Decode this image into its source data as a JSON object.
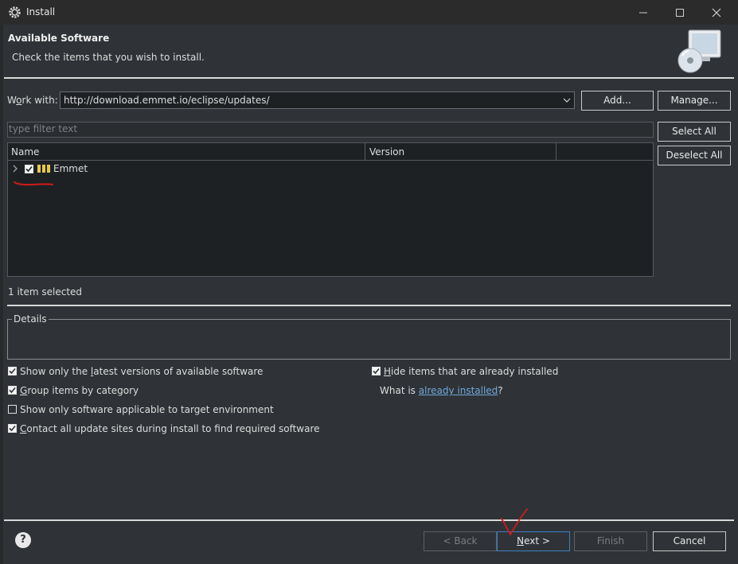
{
  "window": {
    "title": "Install"
  },
  "header": {
    "title": "Available Software",
    "description": "Check the items that you wish to install."
  },
  "work_with": {
    "label_pre": "W",
    "label_u": "o",
    "label_post": "rk with:",
    "value": "http://download.emmet.io/eclipse/updates/",
    "add_label": "Add...",
    "manage_label": "Manage..."
  },
  "filter": {
    "placeholder": "type filter text"
  },
  "buttons": {
    "select_all": "Select All",
    "deselect_all": "Deselect All"
  },
  "table": {
    "columns": [
      "Name",
      "Version"
    ],
    "rows": [
      {
        "name": "Emmet",
        "checked": true
      }
    ]
  },
  "status": "1 item selected",
  "details": {
    "label": "Details"
  },
  "options": {
    "latest_pre": "Show only the ",
    "latest_u": "l",
    "latest_post": "atest versions of available software",
    "group_u": "G",
    "group_post": "roup items by category",
    "target": "Show only software applicable to target environment",
    "contact_u": "C",
    "contact_post": "ontact all update sites during install to find required software",
    "hide_u": "H",
    "hide_post": "ide items that are already installed",
    "what_is": "What is ",
    "already_installed": "already installed",
    "what_is_end": "?"
  },
  "footer": {
    "back": "< Back",
    "next_u": "N",
    "next_post": "ext >",
    "finish": "Finish",
    "cancel": "Cancel"
  },
  "colors": {
    "background": "#2f3337",
    "table_bg": "#1e2124",
    "link": "#6fa8dc",
    "annotation": "#d11a1a"
  }
}
